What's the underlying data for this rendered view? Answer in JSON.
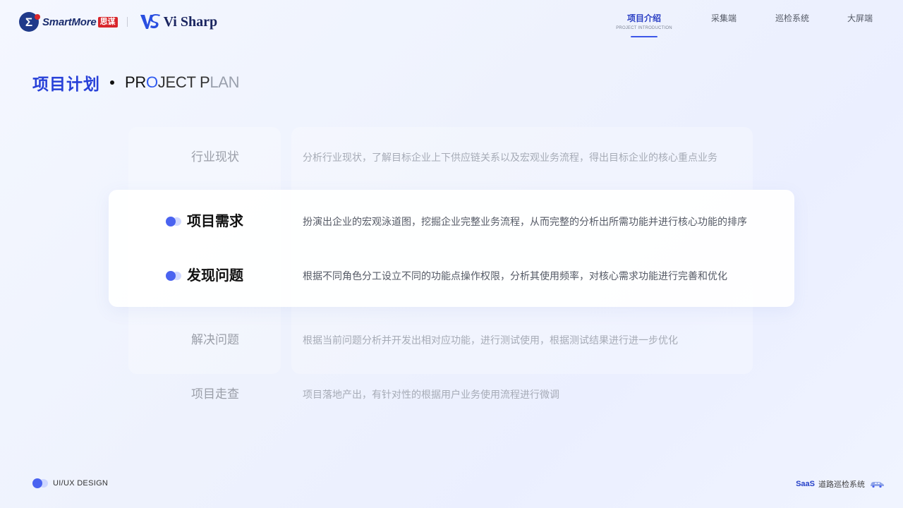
{
  "header": {
    "brand1": {
      "name": "SmartMore",
      "badge": "思谋",
      "icon_glyph": "Σ"
    },
    "brand2": {
      "name": "Vi Sharp"
    },
    "nav": [
      {
        "label": "项目介绍",
        "sub": "PROJECT INTRODUCTION",
        "active": true
      },
      {
        "label": "采集端",
        "sub": "",
        "active": false
      },
      {
        "label": "巡检系统",
        "sub": "",
        "active": false
      },
      {
        "label": "大屏端",
        "sub": "",
        "active": false
      }
    ]
  },
  "section": {
    "title_cn": "项目计划",
    "title_en_parts": [
      "PR",
      "O",
      "JECT P",
      "LAN"
    ]
  },
  "rows": [
    {
      "name": "行业现状",
      "desc": "分析行业现状，了解目标企业上下供应链关系以及宏观业务流程，得出目标企业的核心重点业务",
      "active": false
    },
    {
      "name": "项目需求",
      "desc": "扮演出企业的宏观泳道图，挖掘企业完整业务流程，从而完整的分析出所需功能并进行核心功能的排序",
      "active": true
    },
    {
      "name": "发现问题",
      "desc": "根据不同角色分工设立不同的功能点操作权限，分析其使用频率，对核心需求功能进行完善和优化",
      "active": true
    },
    {
      "name": "解决问题",
      "desc": "根据当前问题分析并开发出相对应功能，进行测试使用，根据测试结果进行进一步优化",
      "active": false
    },
    {
      "name": "项目走查",
      "desc": "项目落地产出，有针对性的根据用户业务使用流程进行微调",
      "active": false
    }
  ],
  "footer": {
    "left": "UI/UX DESIGN",
    "right_saas": "SaaS",
    "right_text": "道路巡检系统",
    "right_icon": "car-icon"
  },
  "colors": {
    "accent": "#2740d8",
    "bullet": "#4a63f0",
    "badge": "#d8262b"
  }
}
